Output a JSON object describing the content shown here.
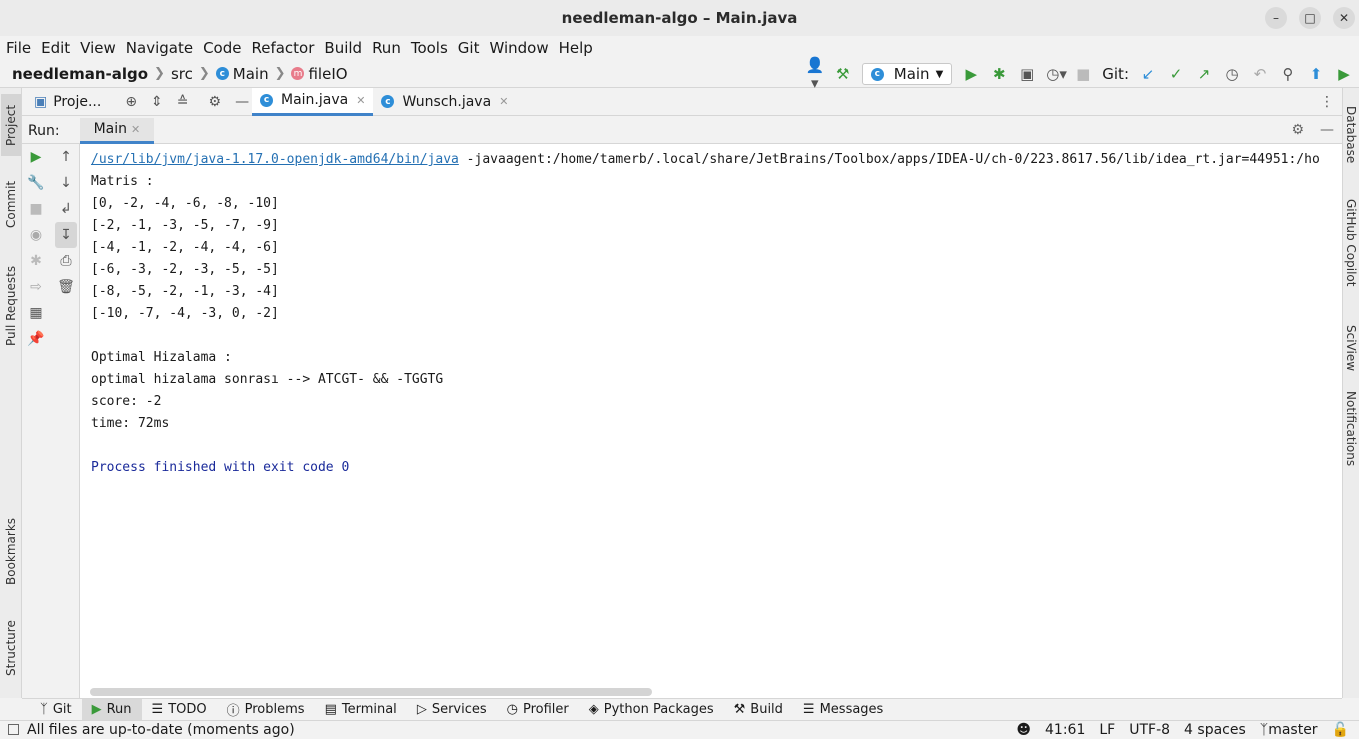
{
  "window": {
    "title": "needleman-algo – Main.java"
  },
  "menu": [
    "File",
    "Edit",
    "View",
    "Navigate",
    "Code",
    "Refactor",
    "Build",
    "Run",
    "Tools",
    "Git",
    "Window",
    "Help"
  ],
  "breadcrumb": {
    "project": "needleman-algo",
    "folder": "src",
    "class": "Main",
    "method": "fileIO"
  },
  "toolbar": {
    "run_config": "Main",
    "git_label": "Git:"
  },
  "left_tabs": [
    "Project",
    "Commit",
    "Pull Requests",
    "Bookmarks",
    "Structure"
  ],
  "right_tabs": [
    "Database",
    "GitHub Copilot",
    "SciView",
    "Notifications"
  ],
  "project_panel": {
    "label": "Proje..."
  },
  "editor_tabs": [
    {
      "label": "Main.java"
    },
    {
      "label": "Wunsch.java"
    }
  ],
  "run_panel": {
    "label": "Run:",
    "tab": "Main"
  },
  "console": {
    "command_path": "/usr/lib/jvm/java-1.17.0-openjdk-amd64/bin/java",
    "command_args": " -javaagent:/home/tamerb/.local/share/JetBrains/Toolbox/apps/IDEA-U/ch-0/223.8617.56/lib/idea_rt.jar=44951:/ho",
    "lines": [
      "Matris :",
      "[0, -2, -4, -6, -8, -10]",
      "[-2, -1, -3, -5, -7, -9]",
      "[-4, -1, -2, -4, -4, -6]",
      "[-6, -3, -2, -3, -5, -5]",
      "[-8, -5, -2, -1, -3, -4]",
      "[-10, -7, -4, -3, 0, -2]",
      "",
      "Optimal Hizalama :",
      "optimal hizalama sonrası --> ATCGT- && -TGGTG",
      "score: -2",
      "time: 72ms",
      ""
    ],
    "exit_line": "Process finished with exit code 0"
  },
  "bottom_tabs": [
    {
      "label": "Git",
      "icon": "git-icon"
    },
    {
      "label": "Run",
      "icon": "run-icon"
    },
    {
      "label": "TODO",
      "icon": "list-icon"
    },
    {
      "label": "Problems",
      "icon": "problems-icon"
    },
    {
      "label": "Terminal",
      "icon": "terminal-icon"
    },
    {
      "label": "Services",
      "icon": "services-icon"
    },
    {
      "label": "Profiler",
      "icon": "profiler-icon"
    },
    {
      "label": "Python Packages",
      "icon": "packages-icon"
    },
    {
      "label": "Build",
      "icon": "hammer-icon"
    },
    {
      "label": "Messages",
      "icon": "messages-icon"
    }
  ],
  "status": {
    "message": "All files are up-to-date (moments ago)",
    "position": "41:61",
    "line_sep": "LF",
    "encoding": "UTF-8",
    "indent": "4 spaces",
    "branch": "master"
  },
  "colors": {
    "accent": "#4083c9",
    "link": "#2470b3",
    "run_green": "#3a9a3a"
  }
}
